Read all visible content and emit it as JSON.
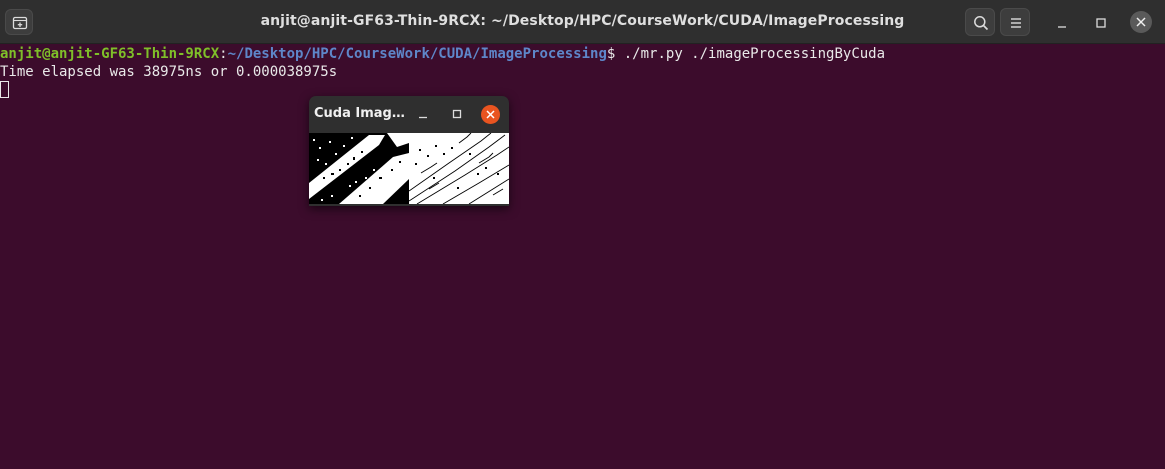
{
  "window": {
    "title": "anjit@anjit-GF63-Thin-9RCX: ~/Desktop/HPC/CourseWork/CUDA/ImageProcessing"
  },
  "titlebar_icons": {
    "new_tab": "new-tab-icon",
    "search": "search-icon",
    "menu": "hamburger-menu-icon",
    "minimize": "minimize-icon",
    "maximize": "maximize-icon",
    "close": "close-icon"
  },
  "terminal": {
    "prompt_user": "anjit@anjit-GF63-Thin-9RCX",
    "prompt_sep": ":",
    "prompt_path": "~/Desktop/HPC/CourseWork/CUDA/ImageProcessing",
    "prompt_symbol": "$ ",
    "command": "./mr.py ./imageProcessingByCuda",
    "output_line": "Time elapsed was 38975ns or 0.000038975s"
  },
  "image_window": {
    "title": "Cuda Imag…"
  },
  "colors": {
    "terminal_bg": "#3c0c2c",
    "titlebar_bg": "#2f2f2f",
    "prompt_user": "#7fbf29",
    "prompt_path": "#5e86c9",
    "close_accent": "#e95420"
  }
}
